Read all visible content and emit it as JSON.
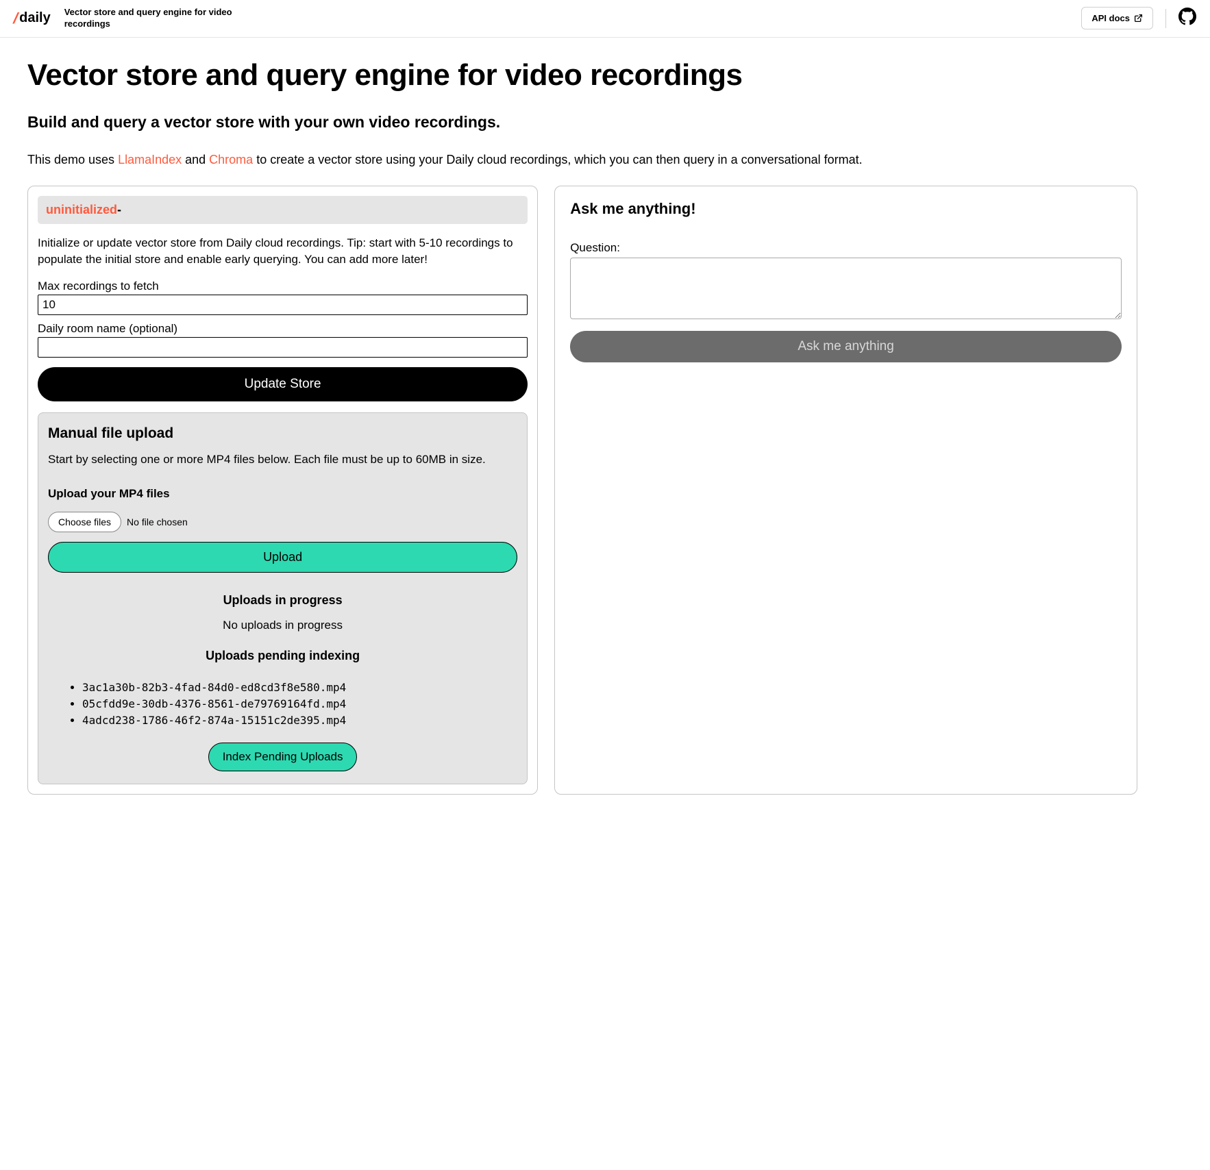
{
  "header": {
    "brand": "daily",
    "subtitle": "Vector store and query engine for video recordings",
    "api_docs_label": "API docs"
  },
  "page": {
    "title": "Vector store and query engine for video recordings",
    "subtitle": "Build and query a vector store with your own video recordings.",
    "intro_prefix": "This demo uses ",
    "link1": "LlamaIndex",
    "intro_mid": " and ",
    "link2": "Chroma",
    "intro_suffix": " to create a vector store using your Daily cloud recordings, which you can then query in a conversational format."
  },
  "init": {
    "status": "uninitialized",
    "dash": "-",
    "description": "Initialize or update vector store from Daily cloud recordings. Tip: start with 5-10 recordings to populate the initial store and enable early querying. You can add more later!",
    "max_label": "Max recordings to fetch",
    "max_value": "10",
    "room_label": "Daily room name (optional)",
    "room_value": "",
    "update_btn": "Update Store"
  },
  "upload": {
    "title": "Manual file upload",
    "description": "Start by selecting one or more MP4 files below. Each file must be up to 60MB in size.",
    "label": "Upload your MP4 files",
    "choose_btn": "Choose files",
    "file_status": "No file chosen",
    "upload_btn": "Upload",
    "progress_title": "Uploads in progress",
    "progress_text": "No uploads in progress",
    "pending_title": "Uploads pending indexing",
    "pending_files": [
      "3ac1a30b-82b3-4fad-84d0-ed8cd3f8e580.mp4",
      "05cfdd9e-30db-4376-8561-de79769164fd.mp4",
      "4adcd238-1786-46f2-874a-15151c2de395.mp4"
    ],
    "index_btn": "Index Pending Uploads"
  },
  "ask": {
    "title": "Ask me anything!",
    "question_label": "Question:",
    "question_value": "",
    "ask_btn": "Ask me anything"
  }
}
